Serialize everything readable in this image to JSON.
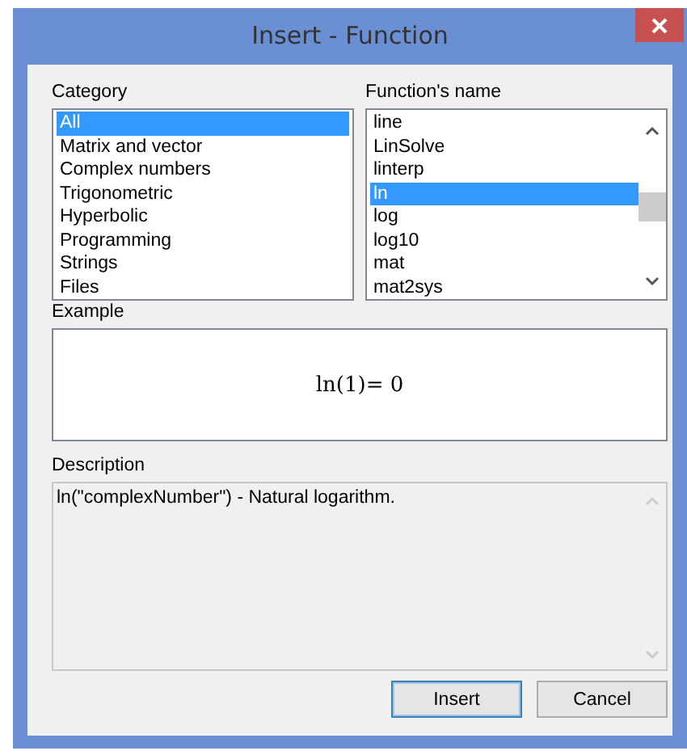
{
  "window": {
    "title": "Insert - Function"
  },
  "category": {
    "label": "Category",
    "items": [
      {
        "text": "All",
        "selected": true
      },
      {
        "text": "Matrix and vector",
        "selected": false
      },
      {
        "text": "Complex numbers",
        "selected": false
      },
      {
        "text": "Trigonometric",
        "selected": false
      },
      {
        "text": "Hyperbolic",
        "selected": false
      },
      {
        "text": "Programming",
        "selected": false
      },
      {
        "text": "Strings",
        "selected": false
      },
      {
        "text": "Files",
        "selected": false
      }
    ]
  },
  "functions": {
    "label": "Function's name",
    "items": [
      {
        "text": "line",
        "selected": false
      },
      {
        "text": "LinSolve",
        "selected": false
      },
      {
        "text": "linterp",
        "selected": false
      },
      {
        "text": "ln",
        "selected": true
      },
      {
        "text": "log",
        "selected": false
      },
      {
        "text": "log10",
        "selected": false
      },
      {
        "text": "mat",
        "selected": false
      },
      {
        "text": "mat2sys",
        "selected": false
      }
    ]
  },
  "example": {
    "label": "Example",
    "formula": "ln(1)= 0"
  },
  "description": {
    "label": "Description",
    "text": "ln(\"complexNumber\") - Natural logarithm."
  },
  "buttons": [
    {
      "label": "Insert",
      "default": true
    },
    {
      "label": "Cancel",
      "default": false
    }
  ]
}
